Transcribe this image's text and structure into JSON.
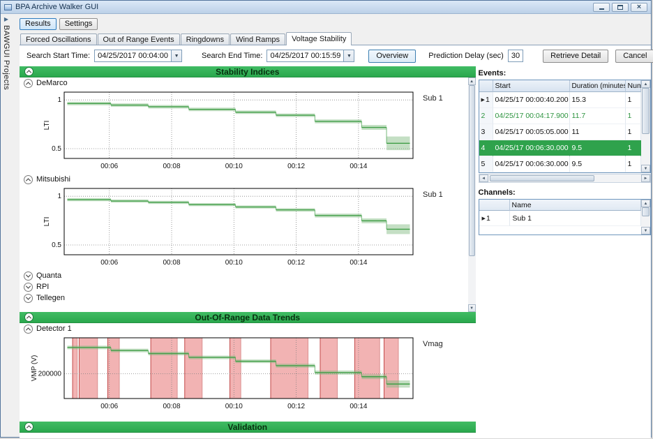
{
  "window": {
    "title": "BPA Archive Walker GUI"
  },
  "sidebar": {
    "label": "BAWGUI Projects"
  },
  "topbar": {
    "results": "Results",
    "settings": "Settings"
  },
  "tabs": [
    {
      "label": "Forced Oscillations",
      "active": false
    },
    {
      "label": "Out of Range Events",
      "active": false
    },
    {
      "label": "Ringdowns",
      "active": false
    },
    {
      "label": "Wind Ramps",
      "active": false
    },
    {
      "label": "Voltage Stability",
      "active": true
    }
  ],
  "toolbar": {
    "search_start_label": "Search Start Time:",
    "search_start_value": "04/25/2017 00:04:00",
    "search_end_label": "Search End Time:",
    "search_end_value": "04/25/2017 00:15:59",
    "overview": "Overview",
    "prediction_delay_label": "Prediction Delay (sec)",
    "prediction_delay_value": "30",
    "retrieve_detail": "Retrieve Detail",
    "cancel": "Cancel"
  },
  "panels": {
    "stability": "Stability Indices",
    "oor": "Out-Of-Range Data Trends",
    "validation": "Validation"
  },
  "expanders": [
    {
      "label": "DeMarco"
    },
    {
      "label": "Mitsubishi"
    },
    {
      "label": "Quanta"
    },
    {
      "label": "RPI"
    },
    {
      "label": "Tellegen"
    },
    {
      "label": "Detector 1"
    }
  ],
  "events": {
    "label": "Events:",
    "columns": [
      "Start",
      "Duration (minutes)",
      "Num"
    ],
    "rows": [
      {
        "n": "1",
        "start": "04/25/17 00:00:40.200",
        "duration": "15.3",
        "num": "1",
        "current": true,
        "selected": false,
        "green_text": false
      },
      {
        "n": "2",
        "start": "04/25/17 00:04:17.900",
        "duration": "11.7",
        "num": "1",
        "current": false,
        "selected": false,
        "green_text": true
      },
      {
        "n": "3",
        "start": "04/25/17 00:05:05.000",
        "duration": "11",
        "num": "1",
        "current": false,
        "selected": false,
        "green_text": false
      },
      {
        "n": "4",
        "start": "04/25/17 00:06:30.000",
        "duration": "9.5",
        "num": "1",
        "current": false,
        "selected": true,
        "green_text": false
      },
      {
        "n": "5",
        "start": "04/25/17 00:06:30.000",
        "duration": "9.5",
        "num": "1",
        "current": false,
        "selected": false,
        "green_text": false
      }
    ]
  },
  "channels": {
    "label": "Channels:",
    "columns": [
      "Name"
    ],
    "rows": [
      {
        "n": "1",
        "name": "Sub 1"
      }
    ]
  },
  "colors": {
    "accent_green": "#2fae53",
    "selection_green": "#2fa24c",
    "line_green": "#3f9e46",
    "band_green": "#7cb87c",
    "band_red": "#efa0a0",
    "band_red_edge": "#c24848"
  },
  "chart_data": [
    {
      "type": "line",
      "title": "DeMarco",
      "ylabel": "LTI",
      "legend": "Sub 1",
      "ylabel_x": 30,
      "xlim": [
        4.55,
        15.75
      ],
      "ylim": [
        0.4,
        1.08
      ],
      "xticks": [
        6,
        8,
        10,
        12,
        14
      ],
      "xtick_labels": [
        "00:06",
        "00:08",
        "00:10",
        "00:12",
        "00:14"
      ],
      "yticks": [
        0.5,
        1
      ],
      "ytick_labels": [
        "0.5",
        "1"
      ],
      "segments": [
        [
          4.65,
          6.05,
          0.963,
          0.018
        ],
        [
          6.05,
          7.25,
          0.947,
          0.018
        ],
        [
          7.25,
          8.55,
          0.93,
          0.018
        ],
        [
          8.55,
          10.05,
          0.903,
          0.018
        ],
        [
          10.05,
          11.35,
          0.874,
          0.018
        ],
        [
          11.35,
          12.6,
          0.843,
          0.018
        ],
        [
          12.6,
          14.1,
          0.78,
          0.02
        ],
        [
          14.1,
          14.9,
          0.718,
          0.025
        ],
        [
          14.9,
          15.65,
          0.555,
          0.07
        ]
      ],
      "bands": []
    },
    {
      "type": "line",
      "title": "Mitsubishi",
      "ylabel": "LTI",
      "legend": "Sub 1",
      "ylabel_x": 30,
      "xlim": [
        4.55,
        15.75
      ],
      "ylim": [
        0.4,
        1.08
      ],
      "xticks": [
        6,
        8,
        10,
        12,
        14
      ],
      "xtick_labels": [
        "00:06",
        "00:08",
        "00:10",
        "00:12",
        "00:14"
      ],
      "yticks": [
        0.5,
        1
      ],
      "ytick_labels": [
        "0.5",
        "1"
      ],
      "segments": [
        [
          4.65,
          6.05,
          0.965,
          0.016
        ],
        [
          6.05,
          7.25,
          0.951,
          0.016
        ],
        [
          7.25,
          8.55,
          0.937,
          0.016
        ],
        [
          8.55,
          10.05,
          0.914,
          0.016
        ],
        [
          10.05,
          11.35,
          0.89,
          0.016
        ],
        [
          11.35,
          12.6,
          0.86,
          0.018
        ],
        [
          12.6,
          14.1,
          0.802,
          0.02
        ],
        [
          14.1,
          14.9,
          0.748,
          0.025
        ],
        [
          14.9,
          15.65,
          0.662,
          0.05
        ]
      ],
      "bands": []
    },
    {
      "type": "line",
      "title": "Detector 1",
      "ylabel": "VMP (V)",
      "legend": "Vmag",
      "ylabel_x": 12,
      "xlim": [
        4.55,
        15.75
      ],
      "ylim": [
        164000,
        252000
      ],
      "xticks": [
        6,
        8,
        10,
        12,
        14
      ],
      "xtick_labels": [
        "00:06",
        "00:08",
        "00:10",
        "00:12",
        "00:14"
      ],
      "yticks": [
        200000
      ],
      "ytick_labels": [
        "200000"
      ],
      "segments": [
        [
          4.65,
          6.05,
          238000,
          2600
        ],
        [
          6.05,
          7.25,
          233600,
          2600
        ],
        [
          7.25,
          8.55,
          229200,
          2600
        ],
        [
          8.55,
          10.05,
          223600,
          2600
        ],
        [
          10.05,
          11.35,
          218000,
          2600
        ],
        [
          11.35,
          12.6,
          211600,
          2800
        ],
        [
          12.6,
          14.1,
          201600,
          3000
        ],
        [
          14.1,
          14.9,
          195600,
          3400
        ],
        [
          14.9,
          15.65,
          185000,
          5200
        ]
      ],
      "bands": [
        [
          4.82,
          4.97
        ],
        [
          5.03,
          5.62
        ],
        [
          5.95,
          6.32
        ],
        [
          7.33,
          8.18
        ],
        [
          8.42,
          8.98
        ],
        [
          9.87,
          10.22
        ],
        [
          11.18,
          12.38
        ],
        [
          12.77,
          13.32
        ],
        [
          13.88,
          14.68
        ],
        [
          14.82,
          15.28
        ]
      ]
    }
  ]
}
